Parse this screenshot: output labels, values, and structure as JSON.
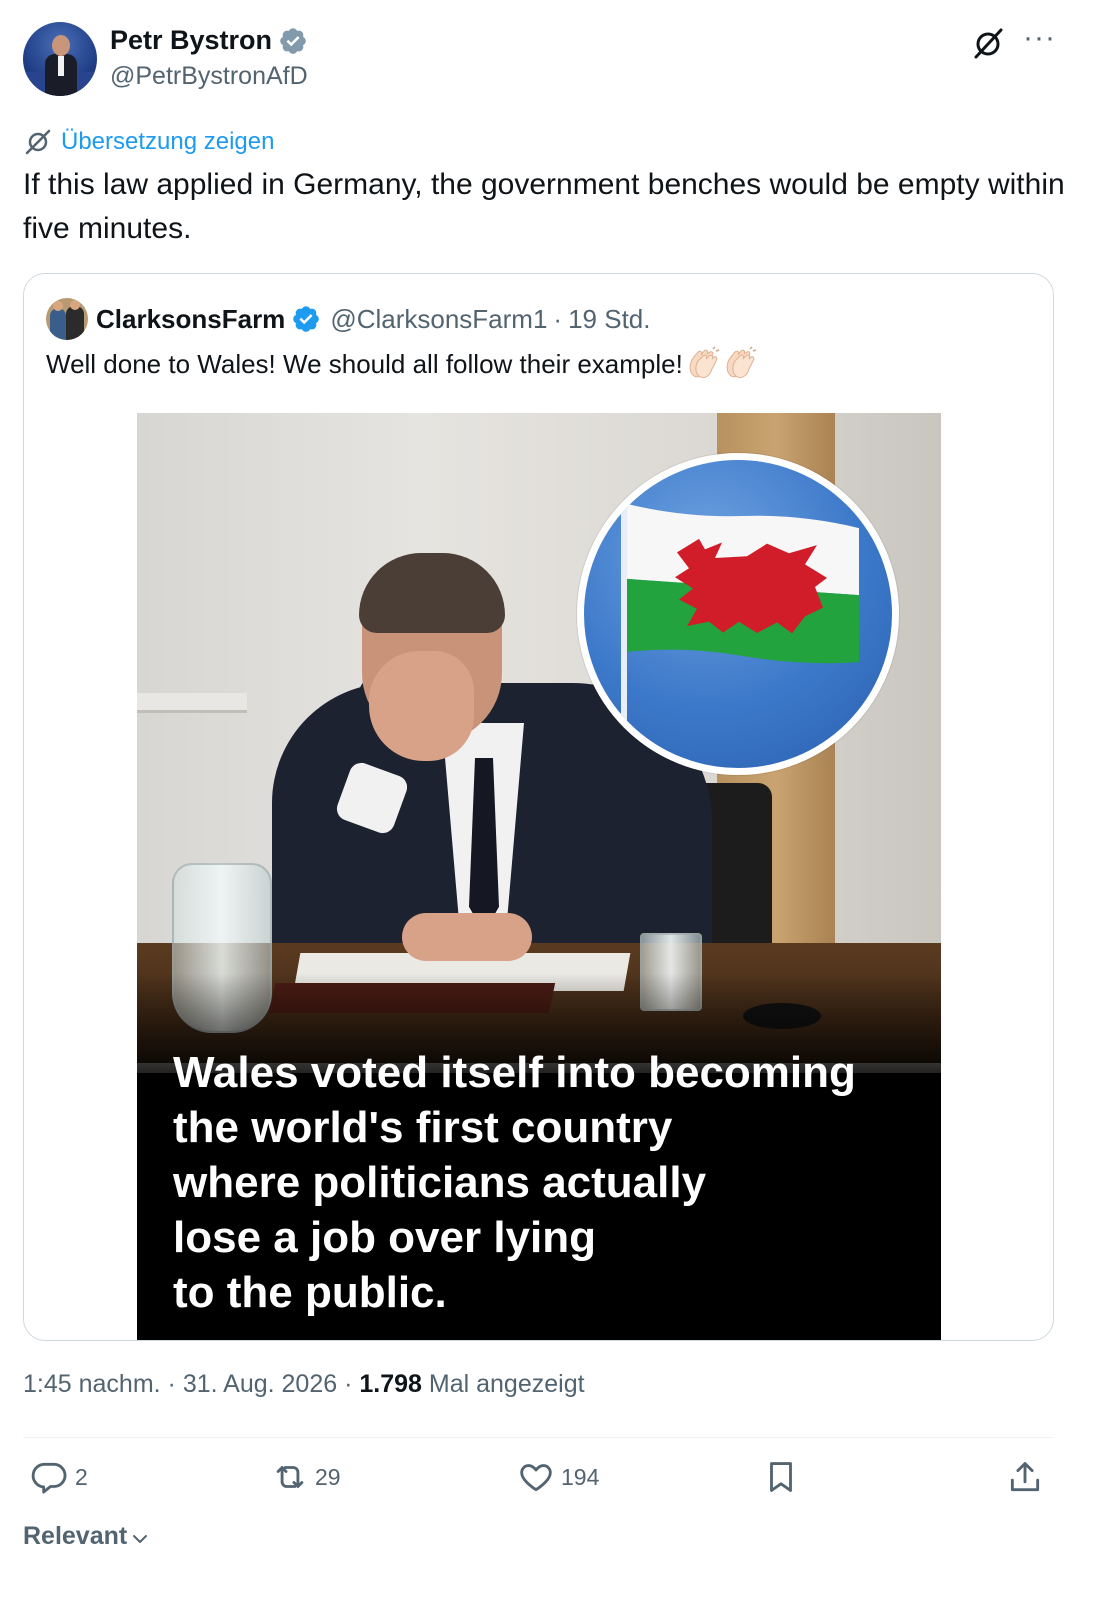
{
  "author": {
    "display_name": "Petr Bystron",
    "handle": "@PetrBystronAfD"
  },
  "translate_link": "Übersetzung zeigen",
  "tweet_text": "If this law applied in Germany, the government benches would be empty within five minutes.",
  "quoted": {
    "display_name": "ClarksonsFarm",
    "handle": "@ClarksonsFarm1",
    "separator": "·",
    "time": "19 Std.",
    "text": "Well done to Wales! We should all follow their example!",
    "image_caption_lines": [
      "Wales voted itself into becoming",
      "the world's first country",
      "where politicians actually",
      "lose a job over lying",
      "to the public."
    ]
  },
  "meta": {
    "time": "1:45 nachm.",
    "separator": "·",
    "date": "31. Aug. 2026",
    "views_count": "1.798",
    "views_label": "Mal angezeigt"
  },
  "actions": {
    "replies": "2",
    "reposts": "29",
    "likes": "194"
  },
  "sort_label": "Relevant",
  "colors": {
    "accent": "#1d9bf0",
    "text_primary": "#0f1419",
    "text_secondary": "#536471",
    "border": "#cfd9de"
  },
  "icons": [
    "verified-badge-icon",
    "grok-icon",
    "more-icon",
    "translate-icon",
    "reply-icon",
    "repost-icon",
    "like-icon",
    "bookmark-icon",
    "share-icon",
    "chevron-down-icon",
    "clap-emoji"
  ]
}
